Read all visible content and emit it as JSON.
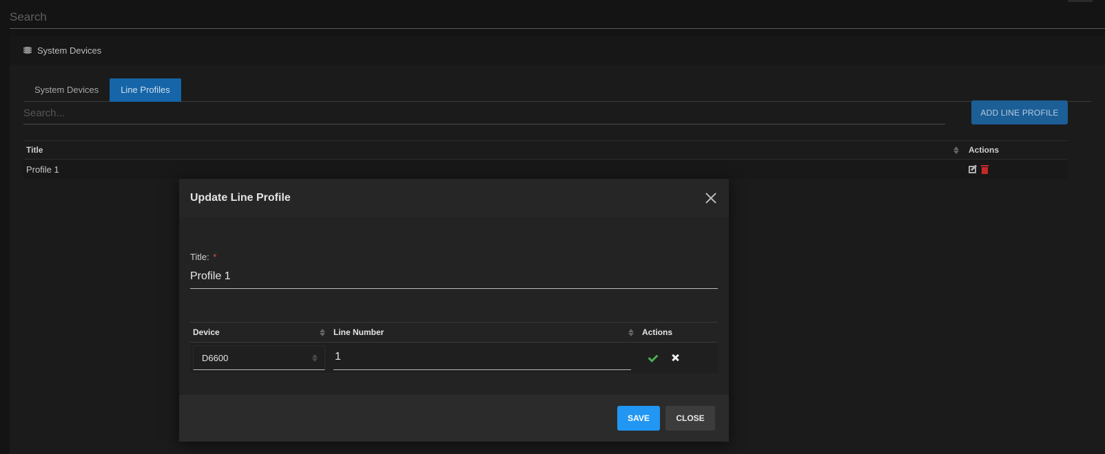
{
  "top_search": {
    "placeholder": "Search"
  },
  "panel": {
    "header_icon": "chip-icon",
    "header_title": "System Devices",
    "tabs": [
      {
        "label": "System Devices",
        "active": false
      },
      {
        "label": "Line Profiles",
        "active": true
      }
    ],
    "search_placeholder": "Search...",
    "add_button_label": "ADD LINE PROFILE",
    "table": {
      "columns": {
        "title": "Title",
        "actions": "Actions"
      },
      "rows": [
        {
          "title": "Profile 1",
          "actions": [
            "edit-icon",
            "trash-icon"
          ]
        }
      ]
    }
  },
  "modal": {
    "title": "Update Line Profile",
    "close_icon": "close-icon",
    "title_field": {
      "label": "Title:",
      "required_mark": "*",
      "value": "Profile 1"
    },
    "lines_table": {
      "columns": {
        "device": "Device",
        "line_number": "Line Number",
        "actions": "Actions"
      },
      "rows": [
        {
          "device": "D6600",
          "line_number": "1",
          "actions": [
            "check-icon",
            "x-icon"
          ]
        }
      ]
    },
    "save_label": "SAVE",
    "close_label": "CLOSE"
  },
  "colors": {
    "accent": "#2196f3",
    "tab_active": "#1565a8",
    "confirm": "#4caf50",
    "delete": "#c62828",
    "required": "#d9534f"
  }
}
